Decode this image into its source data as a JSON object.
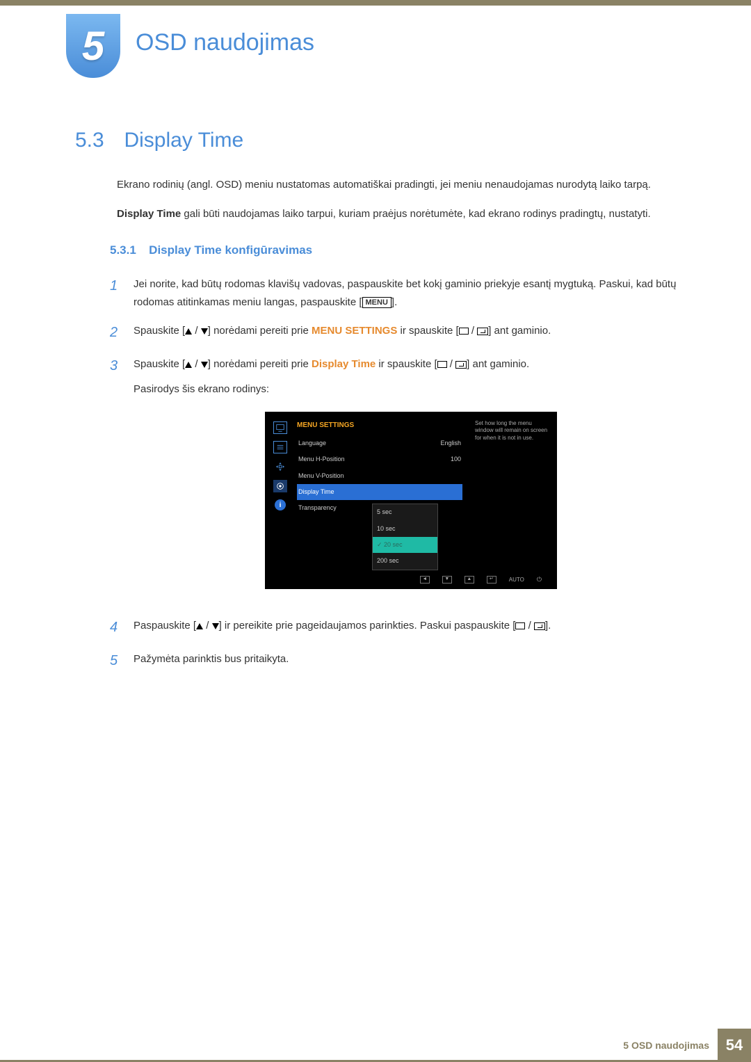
{
  "chapter": {
    "number": "5",
    "title": "OSD naudojimas"
  },
  "section": {
    "number": "5.3",
    "title": "Display Time"
  },
  "intro": {
    "p1": "Ekrano rodinių (angl. OSD) meniu nustatomas automatiškai pradingti, jei meniu nenaudojamas nurodytą laiko tarpą.",
    "p2a": "Display Time",
    "p2b": " gali būti naudojamas laiko tarpui, kuriam praėjus norėtumėte, kad ekrano rodinys pradingtų, nustatyti."
  },
  "subsection": {
    "number": "5.3.1",
    "title": "Display Time konfigūravimas"
  },
  "steps": {
    "s1a": "Jei norite, kad būtų rodomas klavišų vadovas, paspauskite bet kokį gaminio priekyje esantį mygtuką. Paskui, kad būtų rodomas atitinkamas meniu langas, paspauskite [",
    "s1_menu": "MENU",
    "s1b": "].",
    "s2a": "Spauskite [",
    "s2b": "] norėdami pereiti prie ",
    "s2_hl": "MENU SETTINGS",
    "s2c": " ir spauskite [",
    "s2d": "] ant gaminio.",
    "s3a": "Spauskite [",
    "s3b": "] norėdami pereiti prie ",
    "s3_hl": "Display Time",
    "s3c": " ir spauskite [",
    "s3d": "] ant gaminio.",
    "s3e": "Pasirodys šis ekrano rodinys:",
    "s4a": "Paspauskite [",
    "s4b": "] ir pereikite prie pageidaujamos parinkties. Paskui paspauskite [",
    "s4c": "].",
    "s5": "Pažymėta parinktis bus pritaikyta."
  },
  "osd": {
    "head": "MENU SETTINGS",
    "rows": [
      {
        "label": "Language",
        "value": "English"
      },
      {
        "label": "Menu H-Position",
        "value": "100"
      },
      {
        "label": "Menu V-Position",
        "value": ""
      },
      {
        "label": "Display Time",
        "value": ""
      },
      {
        "label": "Transparency",
        "value": ""
      }
    ],
    "popup": [
      "5 sec",
      "10 sec",
      "20 sec",
      "200 sec"
    ],
    "desc": "Set how long the menu window will remain on screen for when it is not in use.",
    "nav_auto": "AUTO"
  },
  "footer": {
    "text": "5 OSD naudojimas",
    "page": "54"
  }
}
